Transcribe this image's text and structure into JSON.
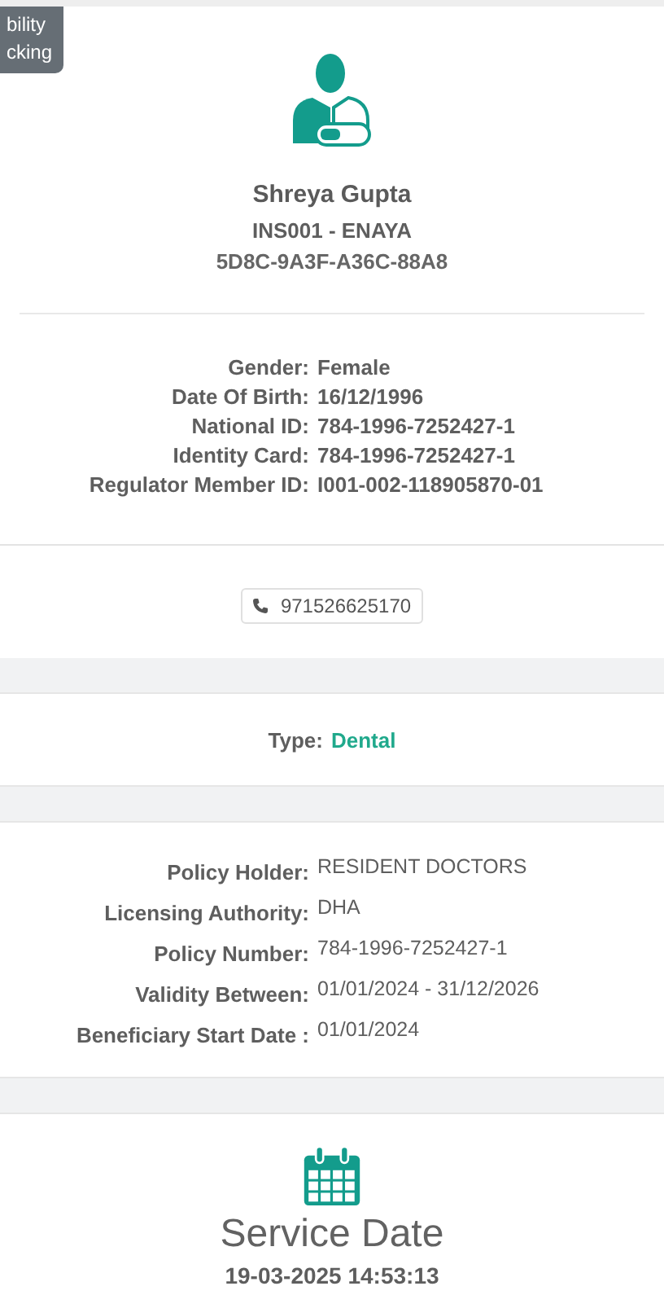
{
  "tooltip": {
    "lines": [
      "bility",
      "cking"
    ]
  },
  "profile": {
    "name": "Shreya Gupta",
    "insurer": "INS001 - ENAYA",
    "code": "5D8C-9A3F-A36C-88A8",
    "details": [
      {
        "label": "Gender:",
        "value": "Female"
      },
      {
        "label": "Date Of Birth:",
        "value": "16/12/1996"
      },
      {
        "label": "National ID:",
        "value": "784-1996-7252427-1"
      },
      {
        "label": "Identity Card:",
        "value": "784-1996-7252427-1"
      },
      {
        "label": "Regulator Member ID:",
        "value": "I001-002-118905870-01"
      }
    ]
  },
  "phone": "971526625170",
  "type": {
    "label": "Type:",
    "value": "Dental"
  },
  "policy": [
    {
      "label": "Policy Holder:",
      "value": "RESIDENT DOCTORS"
    },
    {
      "label": "Licensing Authority:",
      "value": "DHA"
    },
    {
      "label": "Policy Number:",
      "value": "784-1996-7252427-1"
    },
    {
      "label": "Validity Between:",
      "value": "01/01/2024 - 31/12/2026"
    },
    {
      "label": "Beneficiary Start Date :",
      "value": "01/01/2024"
    }
  ],
  "service": {
    "title": "Service Date",
    "datetime": "19-03-2025 14:53:13"
  }
}
